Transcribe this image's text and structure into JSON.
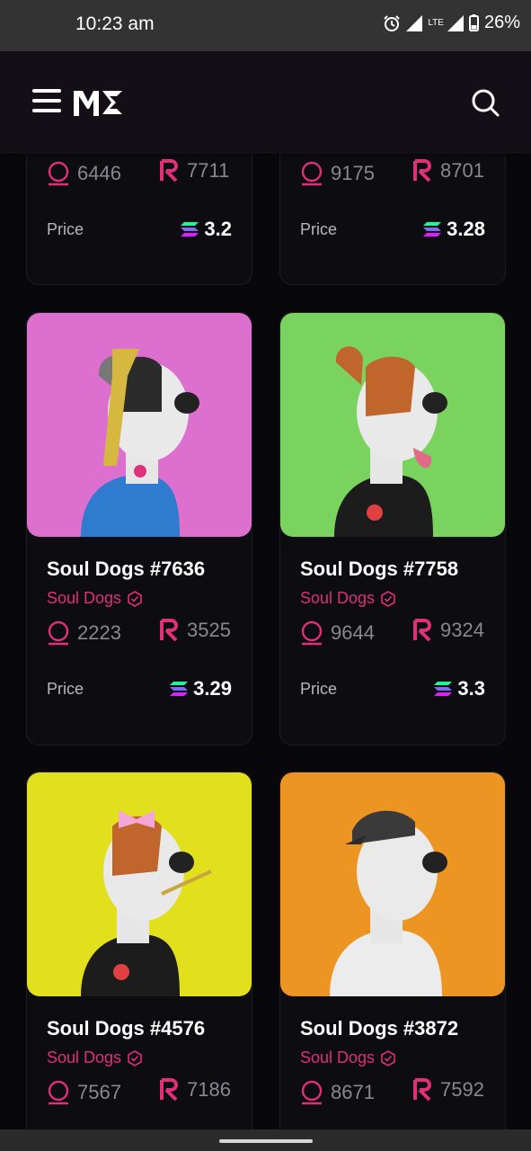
{
  "status": {
    "time": "10:23 am",
    "network": "LTE",
    "battery": "26%"
  },
  "colors": {
    "accent": "#e0307a",
    "background": "#08070b"
  },
  "search_icon": "search-icon",
  "menu_icon": "hamburger-menu-icon",
  "logo": "ME",
  "price_label": "Price",
  "collection_name": "Soul Dogs",
  "top_cards": [
    {
      "owners": "6446",
      "rank": "7711",
      "price": "3.2"
    },
    {
      "owners": "9175",
      "rank": "8701",
      "price": "3.28"
    }
  ],
  "cards": [
    {
      "title": "Soul Dogs #7636",
      "collection": "Soul Dogs",
      "owners": "2223",
      "rank": "3525",
      "price": "3.29",
      "bg": "#dd6fcf"
    },
    {
      "title": "Soul Dogs #7758",
      "collection": "Soul Dogs",
      "owners": "9644",
      "rank": "9324",
      "price": "3.3",
      "bg": "#79d35e"
    },
    {
      "title": "Soul Dogs #4576",
      "collection": "Soul Dogs",
      "owners": "7567",
      "rank": "7186",
      "bg": "#e2e01c"
    },
    {
      "title": "Soul Dogs #3872",
      "collection": "Soul Dogs",
      "owners": "8671",
      "rank": "7592",
      "bg": "#ec9522"
    }
  ]
}
